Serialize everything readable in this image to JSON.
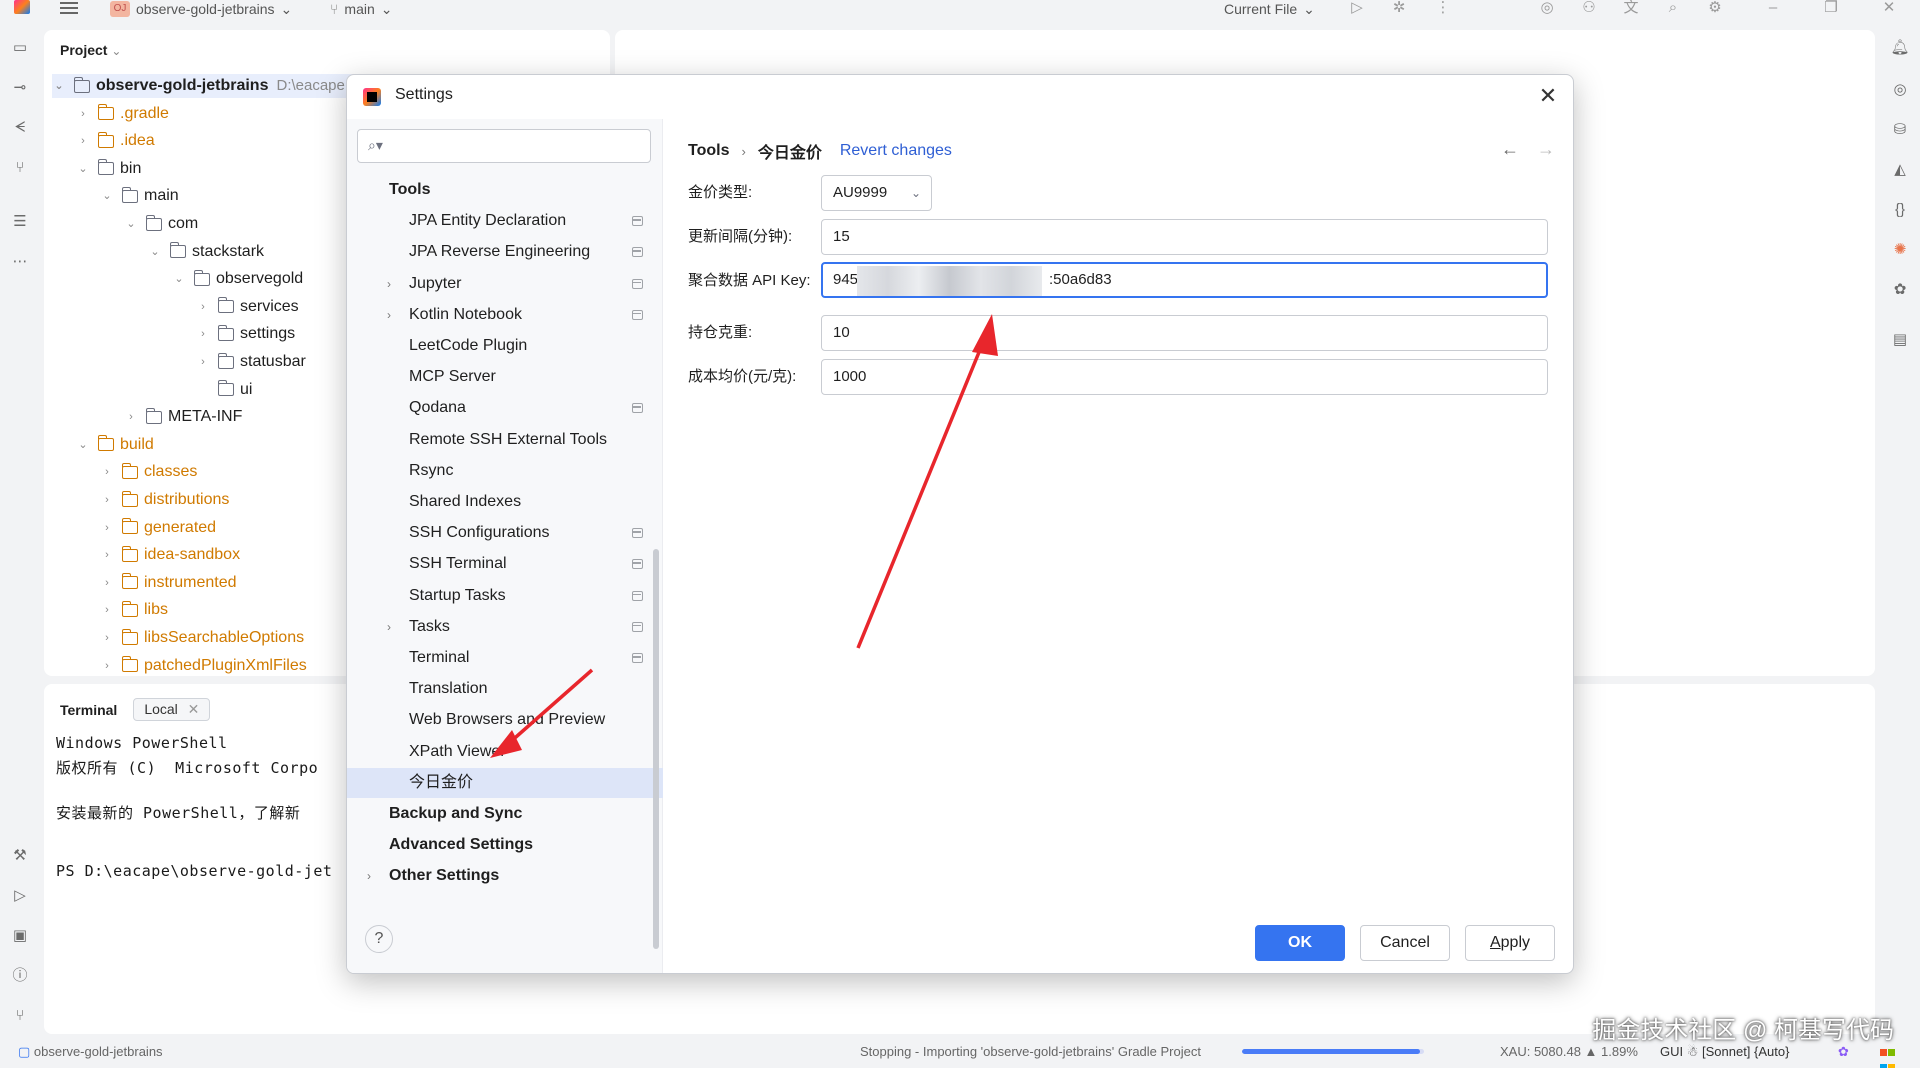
{
  "titlebar": {
    "project_badge": "OJ",
    "project_name": "observe-gold-jetbrains",
    "branch": "main",
    "run_config": "Current File"
  },
  "project": {
    "header": "Project",
    "tree": [
      {
        "label": "observe-gold-jetbrains",
        "path": "D:\\eacape",
        "depth": 0,
        "open": true,
        "root": true
      },
      {
        "label": ".gradle",
        "depth": 1,
        "open": false,
        "excluded": true
      },
      {
        "label": ".idea",
        "depth": 1,
        "open": false,
        "excluded": true
      },
      {
        "label": "bin",
        "depth": 1,
        "open": true
      },
      {
        "label": "main",
        "depth": 2,
        "open": true
      },
      {
        "label": "com",
        "depth": 3,
        "open": true
      },
      {
        "label": "stackstark",
        "depth": 4,
        "open": true
      },
      {
        "label": "observegold",
        "depth": 5,
        "open": true
      },
      {
        "label": "services",
        "depth": 6,
        "open": false
      },
      {
        "label": "settings",
        "depth": 6,
        "open": false
      },
      {
        "label": "statusbar",
        "depth": 6,
        "open": false
      },
      {
        "label": "ui",
        "depth": 6,
        "leaf": true
      },
      {
        "label": "META-INF",
        "depth": 3,
        "open": false
      },
      {
        "label": "build",
        "depth": 1,
        "open": true,
        "excluded": true
      },
      {
        "label": "classes",
        "depth": 2,
        "open": false,
        "excluded": true
      },
      {
        "label": "distributions",
        "depth": 2,
        "open": false,
        "excluded": true
      },
      {
        "label": "generated",
        "depth": 2,
        "open": false,
        "excluded": true
      },
      {
        "label": "idea-sandbox",
        "depth": 2,
        "open": false,
        "excluded": true
      },
      {
        "label": "instrumented",
        "depth": 2,
        "open": false,
        "excluded": true
      },
      {
        "label": "libs",
        "depth": 2,
        "open": false,
        "excluded": true
      },
      {
        "label": "libsSearchableOptions",
        "depth": 2,
        "open": false,
        "excluded": true
      },
      {
        "label": "patchedPluginXmlFiles",
        "depth": 2,
        "open": false,
        "excluded": true
      }
    ]
  },
  "terminal": {
    "title": "Terminal",
    "tab": "Local",
    "lines": [
      "Windows PowerShell",
      "版权所有 (C)  Microsoft Corpo",
      "",
      "安装最新的 PowerShell，了解新",
      "",
      "PS D:\\eacape\\observe-gold-jet"
    ]
  },
  "statusbar": {
    "project": "observe-gold-jetbrains",
    "task": "Stopping - Importing 'observe-gold-jetbrains' Gradle Project",
    "progress": 0.98,
    "xau": "XAU: 5080.48 ▲ 1.89%",
    "gui": "GUI ☃ [Sonnet] {Auto}"
  },
  "watermark": "掘金技术社区 @ 柯基写代码",
  "dialog": {
    "title": "Settings",
    "search_placeholder": "",
    "nav": [
      {
        "label": "Tools",
        "type": "cat",
        "arrow": false
      },
      {
        "label": "JPA Entity Declaration",
        "icon": true
      },
      {
        "label": "JPA Reverse Engineering",
        "icon": true
      },
      {
        "label": "Jupyter",
        "arrow": true,
        "icon": true
      },
      {
        "label": "Kotlin Notebook",
        "arrow": true,
        "icon": true
      },
      {
        "label": "LeetCode Plugin"
      },
      {
        "label": "MCP Server"
      },
      {
        "label": "Qodana",
        "icon": true
      },
      {
        "label": "Remote SSH External Tools"
      },
      {
        "label": "Rsync"
      },
      {
        "label": "Shared Indexes"
      },
      {
        "label": "SSH Configurations",
        "icon": true
      },
      {
        "label": "SSH Terminal",
        "icon": true
      },
      {
        "label": "Startup Tasks",
        "icon": true
      },
      {
        "label": "Tasks",
        "arrow": true,
        "icon": true
      },
      {
        "label": "Terminal",
        "icon": true
      },
      {
        "label": "Translation"
      },
      {
        "label": "Web Browsers and Preview"
      },
      {
        "label": "XPath Viewer"
      },
      {
        "label": "今日金价",
        "selected": true
      },
      {
        "label": "Backup and Sync",
        "type": "cat"
      },
      {
        "label": "Advanced Settings",
        "type": "cat"
      },
      {
        "label": "Other Settings",
        "type": "cat",
        "arrow": true
      }
    ],
    "breadcrumb": {
      "parent": "Tools",
      "current": "今日金价",
      "revert": "Revert changes"
    },
    "form": {
      "type_label": "金价类型:",
      "type_value": "AU9999",
      "interval_label": "更新间隔(分钟):",
      "interval_value": "15",
      "apikey_label": "聚合数据 API Key:",
      "apikey_prefix": "945",
      "apikey_suffix": ":50a6d83",
      "holding_label": "持仓克重:",
      "holding_value": "10",
      "cost_label": "成本均价(元/克):",
      "cost_value": "1000"
    },
    "buttons": {
      "ok": "OK",
      "cancel": "Cancel",
      "apply_a": "A",
      "apply_rest": "pply",
      "help": "?"
    }
  }
}
